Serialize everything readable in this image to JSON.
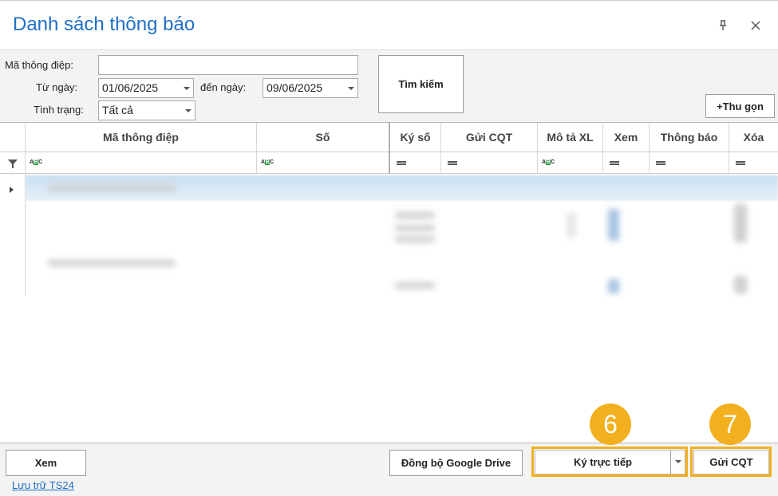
{
  "window": {
    "title": "Danh sách thông báo",
    "pin_icon": "pin-icon",
    "close_icon": "close-icon"
  },
  "filters": {
    "ma_thong_diep_label": "Mã thông điệp:",
    "ma_thong_diep_value": "",
    "tu_ngay_label": "Từ ngày:",
    "tu_ngay_value": "01/06/2025",
    "den_ngay_label": "đến ngày:",
    "den_ngay_value": "09/06/2025",
    "tinh_trang_label": "Tình trạng:",
    "tinh_trang_value": "Tất cả",
    "search_button": "Tìm kiếm",
    "collapse_button": "+Thu gọn"
  },
  "grid": {
    "columns": [
      "Mã thông điệp",
      "Số",
      "Ký số",
      "Gửi CQT",
      "Mô tả XL",
      "Xem",
      "Thông báo",
      "Xóa"
    ],
    "filter_icon": "filter-icon"
  },
  "footer": {
    "view_button": "Xem",
    "sync_button": "Đồng bộ Google Drive",
    "sign_button": "Ký trực tiếp",
    "send_button": "Gửi CQT",
    "storage_link": "Lưu trữ TS24",
    "badge_sign": "6",
    "badge_send": "7",
    "highlight_color": "#f2b01e"
  }
}
